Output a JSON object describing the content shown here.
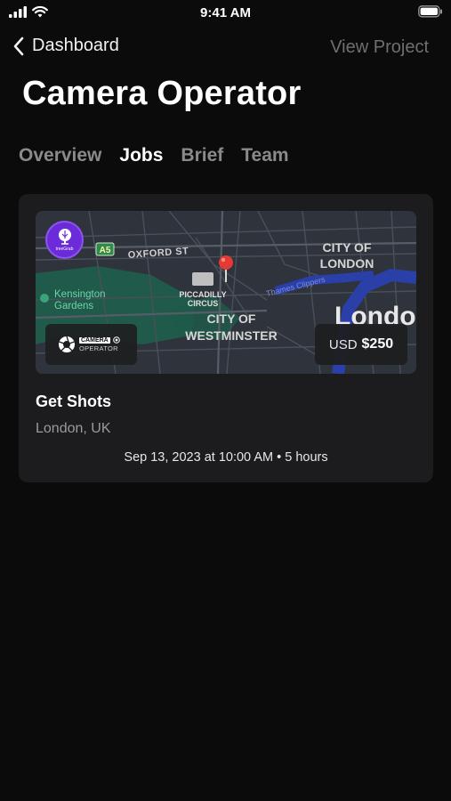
{
  "status_bar": {
    "time": "9:41 AM"
  },
  "nav": {
    "back_label": "Dashboard",
    "action_label": "View Project"
  },
  "page": {
    "title": "Camera Operator"
  },
  "tabs": [
    {
      "label": "Overview",
      "active": false
    },
    {
      "label": "Jobs",
      "active": true
    },
    {
      "label": "Brief",
      "active": false
    },
    {
      "label": "Team",
      "active": false
    }
  ],
  "job_card": {
    "map": {
      "labels": {
        "road": "A5",
        "street": "OXFORD ST",
        "park": "Kensington Gardens",
        "landmark": "PICCADILLY CIRCUS",
        "district": "CITY OF WESTMINSTER",
        "city_area": "CITY OF LONDON",
        "river": "Thames Clippers",
        "city": "London"
      },
      "brand_badge_text": "treeGrab",
      "camera_badge": {
        "word": "CAMERA",
        "sub": "OPERATOR"
      },
      "price": {
        "currency": "USD",
        "amount": "$250"
      }
    },
    "title": "Get Shots",
    "location": "London, UK",
    "meta": "Sep 13, 2023 at 10:00 AM • 5 hours"
  },
  "colors": {
    "background": "#0b0b0b",
    "card": "#1c1c1e",
    "brand_purple": "#6b2bd9",
    "pin_red": "#e53935",
    "river": "#2a3fa8",
    "park": "#1f5a4a"
  }
}
